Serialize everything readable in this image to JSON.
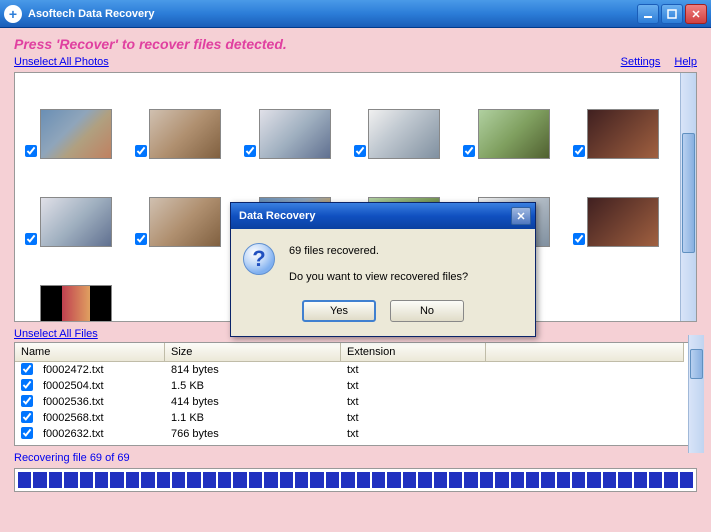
{
  "titlebar": {
    "app_name": "Asoftech Data Recovery"
  },
  "instruction": "Press 'Recover' to recover files detected.",
  "links": {
    "unselect_photos": "Unselect All Photos",
    "settings": "Settings",
    "help": "Help",
    "unselect_files": "Unselect All Files"
  },
  "files": {
    "headers": {
      "name": "Name",
      "size": "Size",
      "ext": "Extension"
    },
    "rows": [
      {
        "name": "f0002472.txt",
        "size": "814 bytes",
        "ext": "txt"
      },
      {
        "name": "f0002504.txt",
        "size": "1.5 KB",
        "ext": "txt"
      },
      {
        "name": "f0002536.txt",
        "size": "414 bytes",
        "ext": "txt"
      },
      {
        "name": "f0002568.txt",
        "size": "1.1 KB",
        "ext": "txt"
      },
      {
        "name": "f0002632.txt",
        "size": "766 bytes",
        "ext": "txt"
      }
    ]
  },
  "status": "Recovering file 69 of 69",
  "dialog": {
    "title": "Data Recovery",
    "line1": "69 files recovered.",
    "line2": "Do you want to view recovered files?",
    "yes": "Yes",
    "no": "No"
  }
}
